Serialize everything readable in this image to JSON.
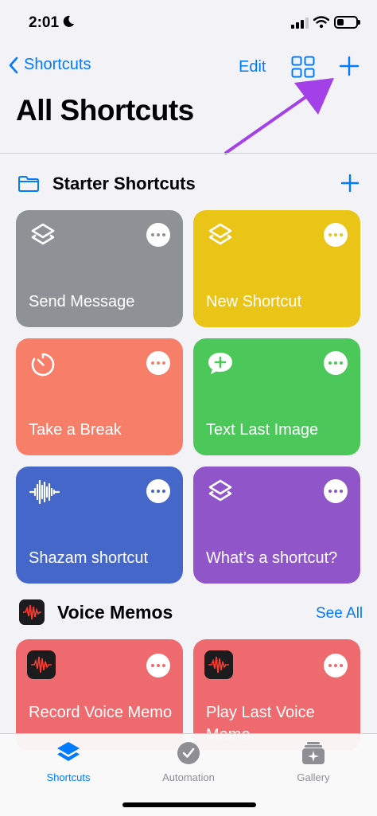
{
  "status_bar": {
    "time": "2:01"
  },
  "nav": {
    "back_label": "Shortcuts",
    "edit_label": "Edit"
  },
  "page_title": "All Shortcuts",
  "starter": {
    "title": "Starter Shortcuts",
    "cards": [
      {
        "name": "Send Message",
        "color": "#8e9296",
        "icon": "layers-icon"
      },
      {
        "name": "New Shortcut",
        "color": "#ebc418",
        "icon": "layers-icon"
      },
      {
        "name": "Take a Break",
        "color": "#f77f6a",
        "icon": "timer-icon"
      },
      {
        "name": "Text Last Image",
        "color": "#4cc75a",
        "icon": "message-plus-icon"
      },
      {
        "name": "Shazam shortcut",
        "color": "#4567c9",
        "icon": "waveform-icon"
      },
      {
        "name": "What’s a shortcut?",
        "color": "#8f55c9",
        "icon": "layers-icon"
      }
    ]
  },
  "voice_memos": {
    "title": "Voice Memos",
    "see_all": "See All",
    "cards": [
      {
        "name": "Record Voice Memo"
      },
      {
        "name": "Play Last Voice Memo"
      }
    ]
  },
  "tabs": [
    {
      "label": "Shortcuts",
      "active": true
    },
    {
      "label": "Automation",
      "active": false
    },
    {
      "label": "Gallery",
      "active": false
    }
  ],
  "colors": {
    "accent": "#007aff",
    "annotation_arrow": "#a340e8"
  }
}
